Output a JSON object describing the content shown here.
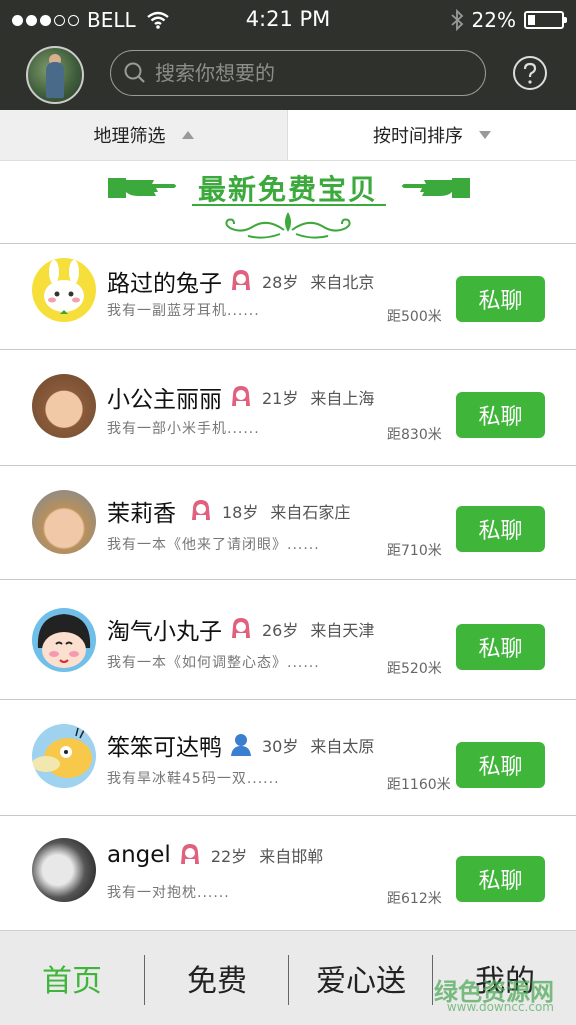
{
  "status_bar": {
    "carrier": "BELL",
    "time": "4:21 PM",
    "battery": "22%",
    "battery_level": 0.22
  },
  "search": {
    "placeholder": "搜索你想要的"
  },
  "filters": [
    {
      "label": "地理筛选"
    },
    {
      "label": "按时间排序"
    }
  ],
  "banner": {
    "title": "最新免费宝贝"
  },
  "list": [
    {
      "name": "路过的兔子",
      "gender": "female",
      "age": "28岁",
      "from": "来自北京",
      "desc": "我有一副蓝牙耳机......",
      "distance": "距500米",
      "action": "私聊"
    },
    {
      "name": "小公主丽丽",
      "gender": "female",
      "age": "21岁",
      "from": "来自上海",
      "desc": "我有一部小米手机......",
      "distance": "距830米",
      "action": "私聊"
    },
    {
      "name": "茉莉香",
      "gender": "female",
      "age": "18岁",
      "from": "来自石家庄",
      "desc": "我有一本《他来了请闭眼》......",
      "distance": "距710米",
      "action": "私聊"
    },
    {
      "name": "淘气小丸子",
      "gender": "female",
      "age": "26岁",
      "from": "来自天津",
      "desc": "我有一本《如何调整心态》......",
      "distance": "距520米",
      "action": "私聊"
    },
    {
      "name": "笨笨可达鸭",
      "gender": "male",
      "age": "30岁",
      "from": "来自太原",
      "desc": "我有旱冰鞋45码一双......",
      "distance": "距1160米",
      "action": "私聊"
    },
    {
      "name": "angel",
      "gender": "female",
      "age": "22岁",
      "from": "来自邯郸",
      "desc": "我有一对抱枕......",
      "distance": "距612米",
      "action": "私聊"
    }
  ],
  "tabbar": [
    {
      "label": "首页",
      "active": true
    },
    {
      "label": "免费"
    },
    {
      "label": "爱心送"
    },
    {
      "label": "我的"
    }
  ],
  "watermark": {
    "text": "绿色资源网",
    "url": "www.downcc.com"
  },
  "colors": {
    "accent": "#3fb53a",
    "header": "#2f312d",
    "female": "#e0607e",
    "male": "#3a7fd0"
  }
}
